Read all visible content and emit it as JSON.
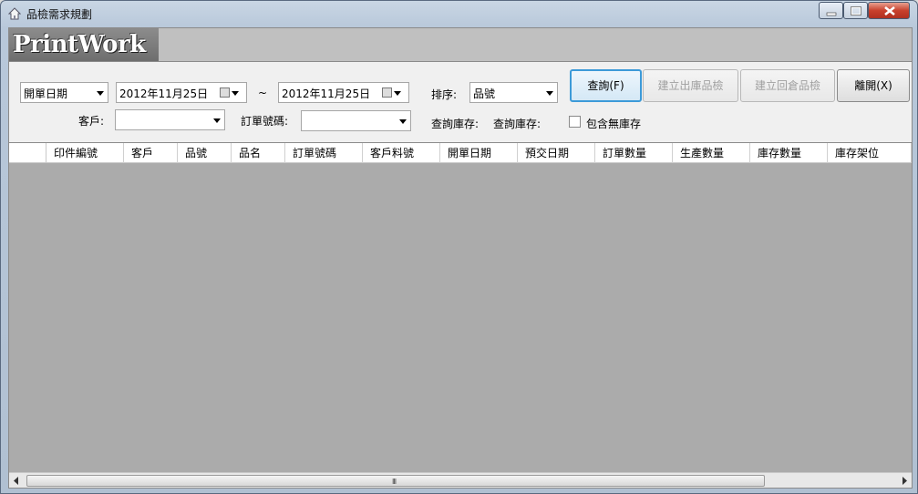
{
  "window": {
    "title": "品檢需求規劃"
  },
  "logo": {
    "text": "PrintWork"
  },
  "filters": {
    "date_type": "開單日期",
    "date_from": "2012年11月25日",
    "date_separator": "~",
    "date_to": "2012年11月25日",
    "sort_label": "排序:",
    "sort_value": "品號",
    "customer_label": "客戶:",
    "customer_value": "",
    "order_no_label": "訂單號碼:",
    "order_no_value": "",
    "stock_query_label_1": "查詢庫存:",
    "stock_query_label_2": "查詢庫存:",
    "include_no_stock_label": "包含無庫存",
    "include_no_stock_checked": false
  },
  "buttons": {
    "query": "查詢(F)",
    "create_out": "建立出庫品檢",
    "create_return": "建立回倉品檢",
    "exit": "離開(X)"
  },
  "grid": {
    "columns": [
      "印件編號",
      "客戶",
      "品號",
      "品名",
      "訂單號碼",
      "客戶料號",
      "開單日期",
      "預交日期",
      "訂單數量",
      "生產數量",
      "庫存數量",
      "庫存架位"
    ],
    "rows": []
  },
  "scrollbar": {
    "grip": "III"
  },
  "colors": {
    "grid_background": "#ababab",
    "accent_border": "#3c9ad8"
  },
  "icons": {
    "title_icon": "home-icon",
    "calendar": "calendar-icon"
  }
}
